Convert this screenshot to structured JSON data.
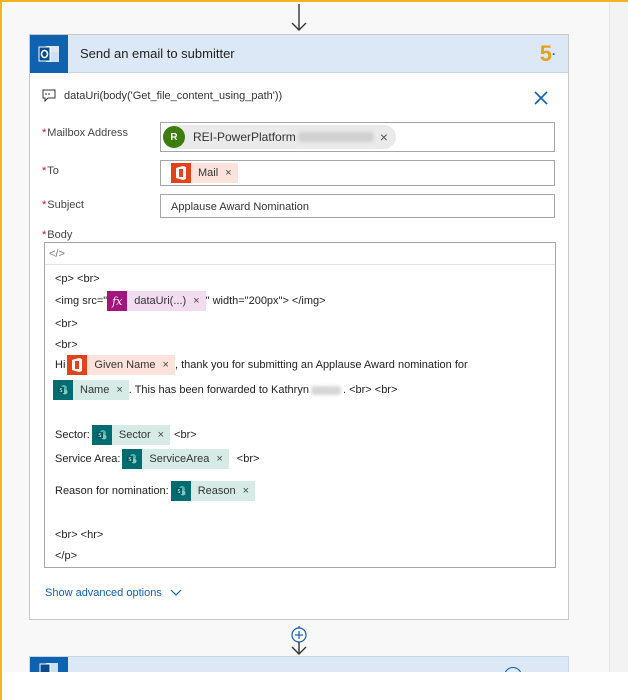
{
  "action": {
    "title": "Send an email to submitter",
    "step_number": "5",
    "step_suffix": "·",
    "info_text": "dataUri(body('Get_file_content_using_path'))"
  },
  "fields": {
    "mailbox": {
      "required_mark": "*",
      "label": "Mailbox Address",
      "avatar_initial": "R",
      "value": "REI-PowerPlatform",
      "remove": "×"
    },
    "to": {
      "required_mark": "*",
      "label": "To",
      "token": "Mail",
      "remove": "×"
    },
    "subject": {
      "required_mark": "*",
      "label": "Subject",
      "value": "Applause Award Nomination"
    },
    "body": {
      "required_mark": "*",
      "label": "Body",
      "code_toggle": "</>",
      "line1": "<p> <br>",
      "line2_prefix": "<img src=\"",
      "line2_token": "dataUri(...)",
      "line2_suffix": "\" width=\"200px\"> </img>",
      "line3": "<br>",
      "line4": "<br>",
      "line5_prefix": "Hi",
      "line5_token": "Given Name",
      "line5_suffix": ", thank you for submitting an Applause Award nomination for",
      "line6_token": "Name",
      "line6_suffix_a": ". This has been forwarded to Kathryn",
      "line6_suffix_b": ". <br> <br>",
      "sector_label": "Sector:",
      "sector_token": "Sector",
      "sector_suffix": "<br>",
      "service_label": "Service Area:",
      "service_token": "ServiceArea",
      "service_suffix": "<br>",
      "reason_label": "Reason for nomination:",
      "reason_token": "Reason",
      "line_end1": "<br> <hr>",
      "line_end2": "</p>",
      "token_remove": "×"
    }
  },
  "advanced": {
    "label": "Show advanced options"
  },
  "colors": {
    "office_orange": "#e2431b",
    "expression_purple": "#a3157e",
    "sharepoint_teal": "#036c70",
    "outlook_blue": "#0f62b0",
    "header_bg": "#dce8f6"
  },
  "icons": {
    "header": "outlook-icon",
    "info": "comment-icon",
    "close": "close-icon",
    "chevron": "chevron-down-icon",
    "add": "plus-circle-icon"
  }
}
